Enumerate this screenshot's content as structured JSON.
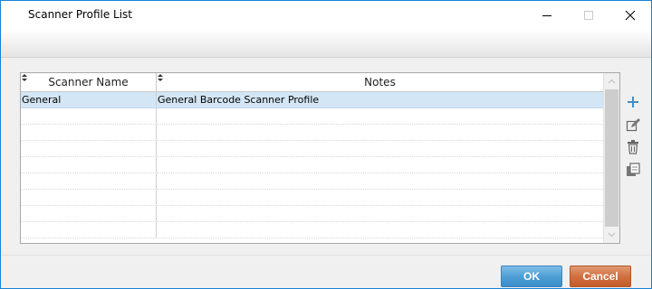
{
  "window": {
    "title": "Scanner Profile List",
    "accent_color": "#1883d7",
    "controls": {
      "minimize_icon": "minimize-icon",
      "maximize_icon": "maximize-icon",
      "close_icon": "close-icon"
    }
  },
  "grid": {
    "columns": [
      {
        "label": "Scanner Name",
        "sort_icon": "sort-arrows-icon"
      },
      {
        "label": "Notes",
        "sort_icon": "sort-arrows-icon"
      }
    ],
    "rows": [
      {
        "name": "General",
        "notes": "General Barcode Scanner Profile",
        "selected": true
      },
      {
        "name": "",
        "notes": ""
      },
      {
        "name": "",
        "notes": ""
      },
      {
        "name": "",
        "notes": ""
      },
      {
        "name": "",
        "notes": ""
      },
      {
        "name": "",
        "notes": ""
      },
      {
        "name": "",
        "notes": ""
      },
      {
        "name": "",
        "notes": ""
      },
      {
        "name": "",
        "notes": ""
      }
    ],
    "selected_row_color": "#d3e6f5"
  },
  "side_tools": [
    {
      "icon": "add-icon"
    },
    {
      "icon": "edit-icon"
    },
    {
      "icon": "delete-icon"
    },
    {
      "icon": "copy-icon"
    }
  ],
  "footer": {
    "ok_label": "OK",
    "cancel_label": "Cancel",
    "ok_color": "#4f9fd6",
    "cancel_color": "#d2703f"
  }
}
